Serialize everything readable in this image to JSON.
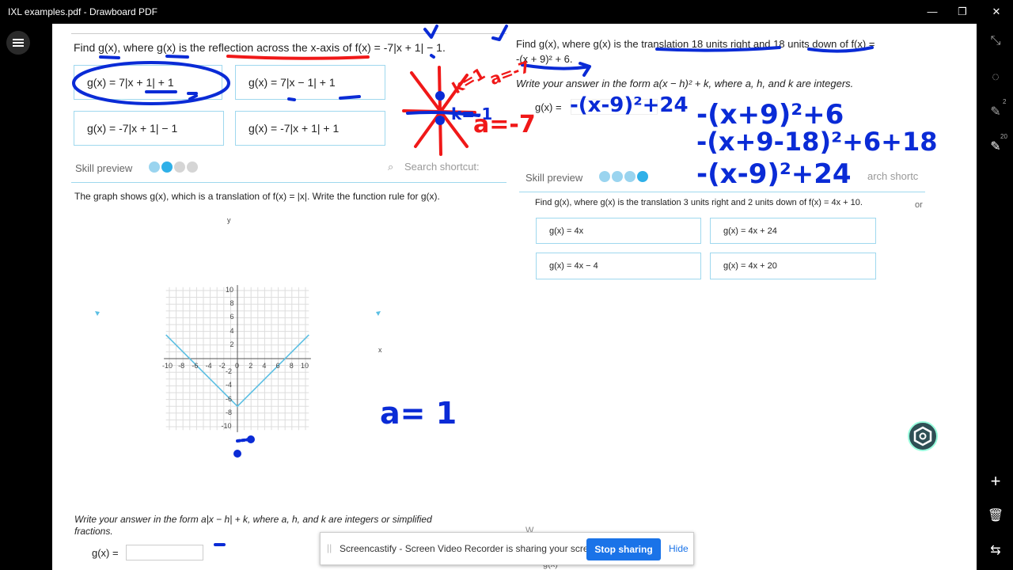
{
  "window": {
    "title": "IXL examples.pdf - Drawboard PDF",
    "minimize": "—",
    "restore": "❐",
    "close": "✕"
  },
  "tools": {
    "pen1_badge": "2",
    "pen2_badge": "20"
  },
  "q1": {
    "prompt": "Find g(x), where g(x) is the reflection across the x-axis of f(x) = -7|x + 1| − 1.",
    "choices": [
      "g(x) = 7|x + 1| + 1",
      "g(x) = 7|x − 1| + 1",
      "g(x) = -7|x + 1| − 1",
      "g(x) = -7|x + 1| + 1"
    ]
  },
  "skill_preview": "Skill preview",
  "search_shortcut": "Search shortcut:",
  "search_partial": "arch shortc",
  "q2": {
    "prompt": "The graph shows g(x), which is a translation of f(x) = |x|. Write the function rule for g(x).",
    "answer_form": "Write your answer in the form a|x − h| + k, where a, h, and k are integers or simplified",
    "answer_form2": "fractions.",
    "input_label": "g(x) ="
  },
  "graph": {
    "x_ticks": [
      "-10",
      "-8",
      "-6",
      "-4",
      "-2",
      "0",
      "2",
      "4",
      "6",
      "8",
      "10"
    ],
    "y_ticks": [
      "10",
      "8",
      "6",
      "4",
      "2",
      "-2",
      "-4",
      "-6",
      "-8",
      "-10"
    ],
    "x_label": "x",
    "y_label": "y"
  },
  "q3": {
    "prompt_line1": "Find g(x), where g(x) is the translation 18 units right and 18 units down of f(x) =",
    "prompt_line2": "-(x + 9)² + 6.",
    "answer_form": "Write your answer in the form a(x − h)² + k, where a, h, and k are integers.",
    "input_label": "g(x) ="
  },
  "q4": {
    "prompt": "Find g(x), where g(x) is the translation 3 units right and 2 units down of f(x) = 4x + 10.",
    "choices": [
      "g(x) = 4x",
      "g(x) = 4x + 24",
      "g(x) = 4x − 4",
      "g(x) = 4x + 20"
    ],
    "trailing": "or"
  },
  "bottom_partial": "g(x) =",
  "bottom_partial2": "W",
  "handwriting": {
    "k_eq_1": "k=1",
    "a_eq_neg7_top": "a=-7",
    "k_eq_neg1": "k=-1",
    "a_eq_neg7": "a=-7",
    "answer": "-(x-9)²+24",
    "step1": "-(x+9)²+6",
    "step2": "-(x+9-18)²+6+18",
    "step3": "-(x-9)²+24",
    "a_eq_1": "a= 1"
  },
  "banner": {
    "message": "Screencastify - Screen Video Recorder is sharing your screen.",
    "stop": "Stop sharing",
    "hide": "Hide"
  },
  "colors": {
    "accent": "#2fb0e8",
    "ink_blue": "#0a2bd6",
    "ink_red": "#f01818",
    "graph_line": "#5bbfe3"
  }
}
